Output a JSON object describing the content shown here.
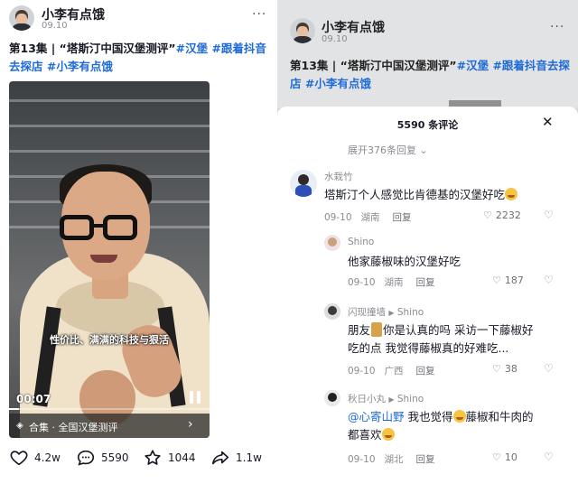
{
  "post": {
    "username": "小李有点饿",
    "date": "09.10",
    "more_label": "···",
    "caption_plain": "第13集 | “塔斯汀中国汉堡测评”",
    "tags": [
      "#汉堡",
      "#跟着抖音去探店",
      "#小李有点饿"
    ],
    "video": {
      "subtitle": "性价比、满满的科技与狠活",
      "time": "00:07",
      "progress": 0.05,
      "collection": "合集 · 全国汉堡测评"
    },
    "actions": {
      "likes": "4.2w",
      "comments": "5590",
      "favorites": "1044",
      "shares": "1.1w"
    }
  },
  "comments_sheet": {
    "title": "5590 条评论",
    "expand": "展开376条回复",
    "comments": [
      {
        "name": "水栽竹",
        "text": "塔斯汀个人感觉比肯德基的汉堡好吃",
        "date": "09-10",
        "location": "湖南",
        "reply_label": "回复",
        "likes": "2232"
      },
      {
        "name": "Shino",
        "text": "他家藤椒味的汉堡好吃",
        "date": "09-10",
        "location": "湖南",
        "reply_label": "回复",
        "likes": "187"
      },
      {
        "name": "闪现撞墙",
        "reply_to": "Shino",
        "text_a": "朋友",
        "text_b": "你是认真的吗 采访一下藤椒好",
        "text_c": "吃的点 我觉得藤椒真的好难吃...",
        "date": "09-10",
        "location": "广西",
        "reply_label": "回复",
        "likes": "38"
      },
      {
        "name": "秋日小丸",
        "reply_to": "Shino",
        "mention": "@心寄山野",
        "text_a": "我也觉得",
        "text_b": "藤椒和牛肉的",
        "text_c": "都喜欢",
        "date": "09-10",
        "location": "湖北",
        "reply_label": "回复",
        "likes": "10"
      }
    ]
  },
  "colors": {
    "hashtag": "#1f6bd6",
    "muted": "#8a8b91",
    "overlay": "#d9dadc"
  }
}
